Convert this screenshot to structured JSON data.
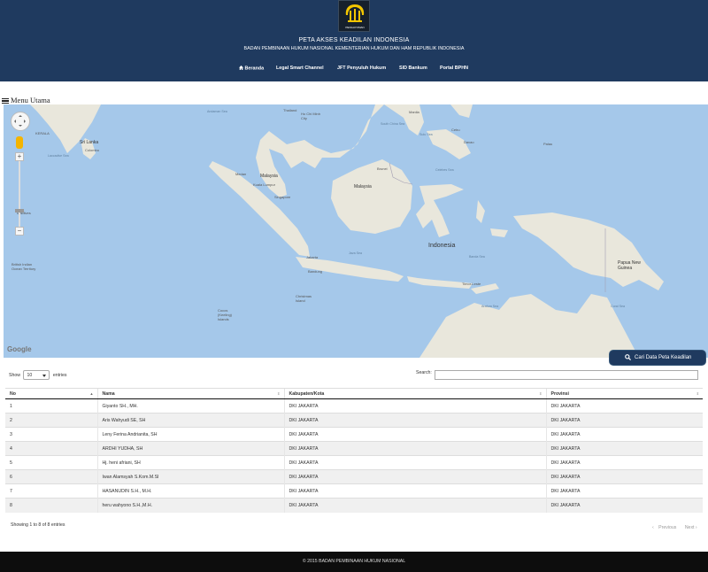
{
  "header": {
    "logo_text": "PENGAYOMAN",
    "title": "PETA AKSES KEADILAN INDONESIA",
    "subtitle": "BADAN PEMBINAAN HUKUM NASIONAL KEMENTERIAN HUKUM DAN HAM REPUBLIK INDONESIA",
    "nav": [
      {
        "label": "Beranda",
        "icon": "home-icon"
      },
      {
        "label": "Legal Smart Channel"
      },
      {
        "label": "JFT Penyuluh Hukum"
      },
      {
        "label": "SID Bankum"
      },
      {
        "label": "Portal BPHN"
      }
    ]
  },
  "menu": {
    "label": "Menu Utama",
    "icon": "hamburger-icon"
  },
  "map": {
    "labels": {
      "sri_lanka": "Sri Lanka",
      "colombo": "Colombo",
      "malaysia_west": "Malaysia",
      "malaysia_east": "Malaysia",
      "singapore": "Singapore",
      "kuala_lumpur": "Kuala Lumpur",
      "indonesia": "Indonesia",
      "papua_new_guinea": "Papua New Guinea",
      "jakarta": "Jakarta",
      "bandung": "Bandung",
      "medan": "Medan",
      "ho_chi_minh": "Ho Chi Minh City",
      "manila": "Manila",
      "cebu": "Cebu",
      "davao": "Davao",
      "palau": "Palau",
      "dili": "Timor-Leste",
      "christmas": "Christmas Island",
      "cocos": "Cocos (Keeling) Islands",
      "biot": "British Indian Ocean Territory",
      "java_sea": "Java Sea",
      "banda_sea": "Banda Sea",
      "arafura_sea": "Arafura Sea",
      "andaman_sea": "Andaman Sea",
      "south_china_sea": "South China Sea",
      "sulu_sea": "Sulu Sea",
      "celebes_sea": "Celebes Sea",
      "coral_sea": "Coral Sea",
      "maldives": "Maldives",
      "thailand": "Thailand",
      "brunei": "Brunei",
      "kerala": "KERALA",
      "laccadive": "Laccadive Sea"
    },
    "google": "Google",
    "zoom_in": "+",
    "zoom_out": "−"
  },
  "search_peta_button": "Cari Data Peta Keadilan",
  "table": {
    "show_label": "Show",
    "entries_value": "10",
    "entries_label": "entries",
    "search_label": "Search:",
    "search_value": "",
    "columns": [
      "No",
      "Nama",
      "Kabupaten/Kota",
      "Provinsi"
    ],
    "rows": [
      [
        "1",
        "Giyanto SH., MH.",
        "DKI JAKARTA",
        "DKI JAKARTA"
      ],
      [
        "2",
        "Aris Wahyudi SE, SH",
        "DKI JAKARTA",
        "DKI JAKARTA"
      ],
      [
        "3",
        "Leny Ferina Andrianita, SH",
        "DKI JAKARTA",
        "DKI JAKARTA"
      ],
      [
        "4",
        "ARDHI YUDHA, SH",
        "DKI JAKARTA",
        "DKI JAKARTA"
      ],
      [
        "5",
        "Hj. heni afriani, SH",
        "DKI JAKARTA",
        "DKI JAKARTA"
      ],
      [
        "6",
        "Iwan Alamsyah S.Kom.M.SI",
        "DKI JAKARTA",
        "DKI JAKARTA"
      ],
      [
        "7",
        "HASANUDIN S.H., M.H.",
        "DKI JAKARTA",
        "DKI JAKARTA"
      ],
      [
        "8",
        "heru wahyono S.H.,M.H.",
        "DKI JAKARTA",
        "DKI JAKARTA"
      ]
    ],
    "info": "Showing 1 to 8 of 8 entries",
    "previous": "Previous",
    "next": "Next"
  },
  "footer": {
    "text": "© 2015 BADAN PEMBINAAN HUKUM NASIONAL"
  }
}
